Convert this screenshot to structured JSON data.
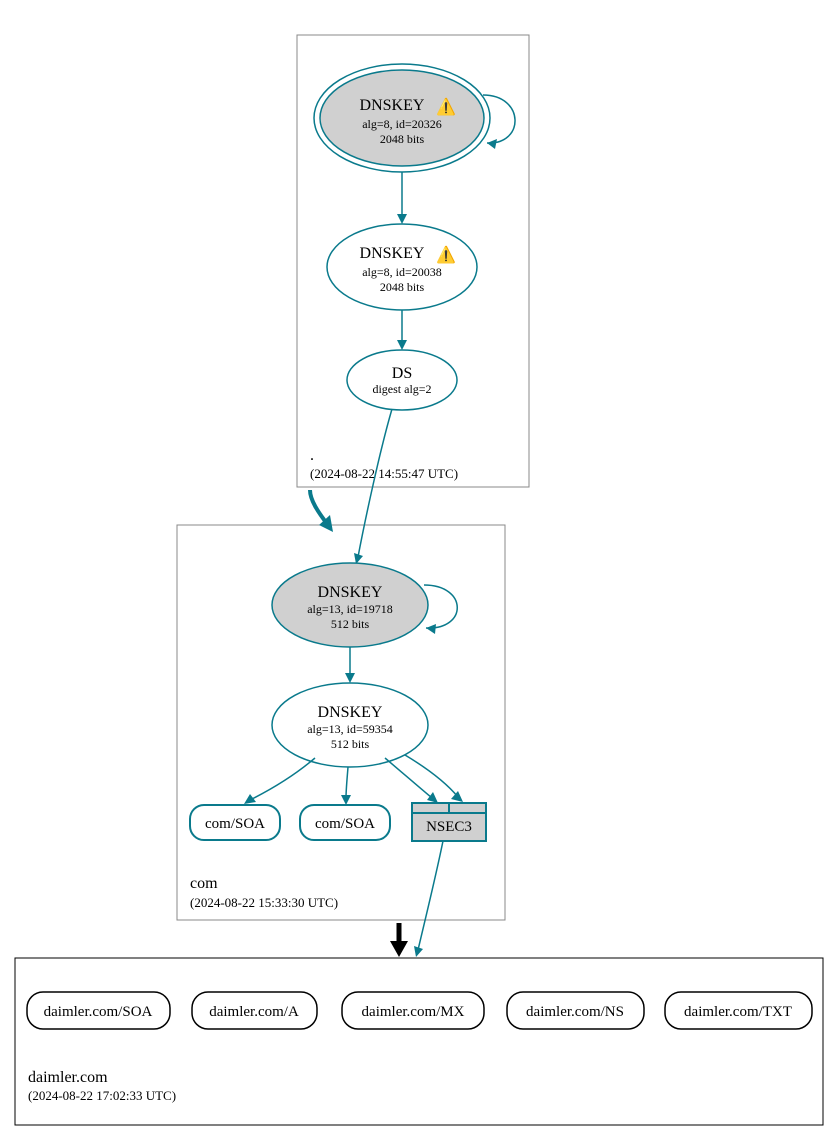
{
  "zones": {
    "root": {
      "label": ".",
      "timestamp": "(2024-08-22 14:55:47 UTC)"
    },
    "com": {
      "label": "com",
      "timestamp": "(2024-08-22 15:33:30 UTC)"
    },
    "daimler": {
      "label": "daimler.com",
      "timestamp": "(2024-08-22 17:02:33 UTC)"
    }
  },
  "nodes": {
    "root_ksk": {
      "title": "DNSKEY",
      "warn": "⚠️",
      "line2": "alg=8, id=20326",
      "line3": "2048 bits"
    },
    "root_zsk": {
      "title": "DNSKEY",
      "warn": "⚠️",
      "line2": "alg=8, id=20038",
      "line3": "2048 bits"
    },
    "root_ds": {
      "title": "DS",
      "line2": "digest alg=2"
    },
    "com_ksk": {
      "title": "DNSKEY",
      "line2": "alg=13, id=19718",
      "line3": "512 bits"
    },
    "com_zsk": {
      "title": "DNSKEY",
      "line2": "alg=13, id=59354",
      "line3": "512 bits"
    },
    "com_soa1": "com/SOA",
    "com_soa2": "com/SOA",
    "nsec3": "NSEC3",
    "d_soa": "daimler.com/SOA",
    "d_a": "daimler.com/A",
    "d_mx": "daimler.com/MX",
    "d_ns": "daimler.com/NS",
    "d_txt": "daimler.com/TXT"
  }
}
